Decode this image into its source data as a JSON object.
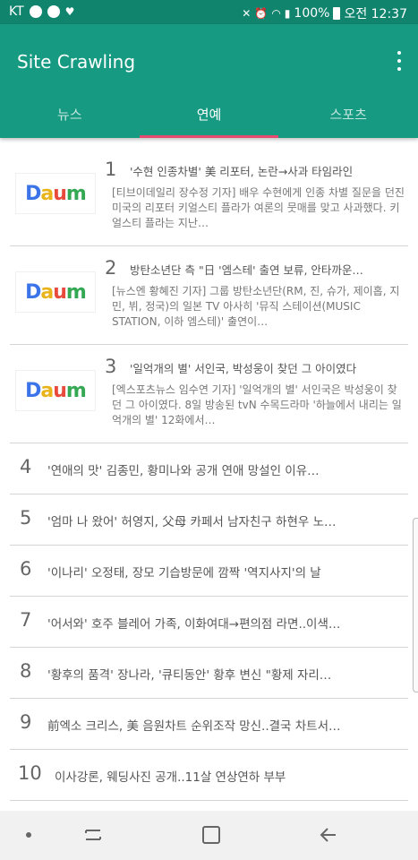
{
  "status": {
    "carrier": "KT",
    "battery": "100%",
    "time": "오전 12:37"
  },
  "app": {
    "title": "Site Crawling"
  },
  "tabs": [
    {
      "label": "뉴스"
    },
    {
      "label": "연예"
    },
    {
      "label": "스포츠"
    }
  ],
  "rich_items": [
    {
      "num": "1",
      "logo": "Daum",
      "title": "'수현 인종차별' 美 리포터, 논란→사과 타임라인",
      "desc": "[티브이데일리 장수정 기자] 배우 수현에게 인종 차별 질문을 던진 미국의 리포터 키얼스티 플라가 여론의 뭇매를 맞고 사과했다. 키얼스티 플라는 지난…"
    },
    {
      "num": "2",
      "logo": "Daum",
      "title": "방탄소년단 측 \"日 '엠스테' 출연 보류, 안타까운…",
      "desc": "[뉴스엔 황혜진 기자] 그룹 방탄소년단(RM, 진, 슈가, 제이홉, 지민, 뷔, 정국)의 일본 TV 아사히 '뮤직 스테이션(MUSIC STATION, 이하 엠스테)' 출연이…"
    },
    {
      "num": "3",
      "logo": "Daum",
      "title": "'일억개의 별' 서인국, 박성웅이 찾던 그 아이였다",
      "desc": "[엑스포츠뉴스 임수연 기자] '일억개의 별' 서인국은 박성웅이 찾던 그 아이였다. 8일 방송된 tvN 수목드라마 '하늘에서 내리는 일억개의 별' 12화에서…"
    }
  ],
  "simple_items": [
    {
      "num": "4",
      "title": "'연애의 맛' 김종민, 황미나와 공개 연애 망설인 이유…"
    },
    {
      "num": "5",
      "title": "'엄마 나 왔어' 허영지, 父母 카페서 남자친구 하현우 노…"
    },
    {
      "num": "6",
      "title": "'이나리' 오정태, 장모 기습방문에 깜짝 '역지사지'의 날"
    },
    {
      "num": "7",
      "title": "'어서와' 호주 블레어 가족, 이화여대→편의점 라면..이색…"
    },
    {
      "num": "8",
      "title": "'황후의 품격' 장나라, '큐티동안' 황후 변신 \"황제 자리…"
    },
    {
      "num": "9",
      "title": "前엑소 크리스, 美 음원차트 순위조작 망신..결국 차트서…"
    },
    {
      "num": "10",
      "title": "이사강론, 웨딩사진 공개..11살 연상연하 부부"
    }
  ],
  "colors": {
    "status_bar": "#11846e",
    "app_bar": "#179a82",
    "tab_indicator": "#e84a6f"
  }
}
